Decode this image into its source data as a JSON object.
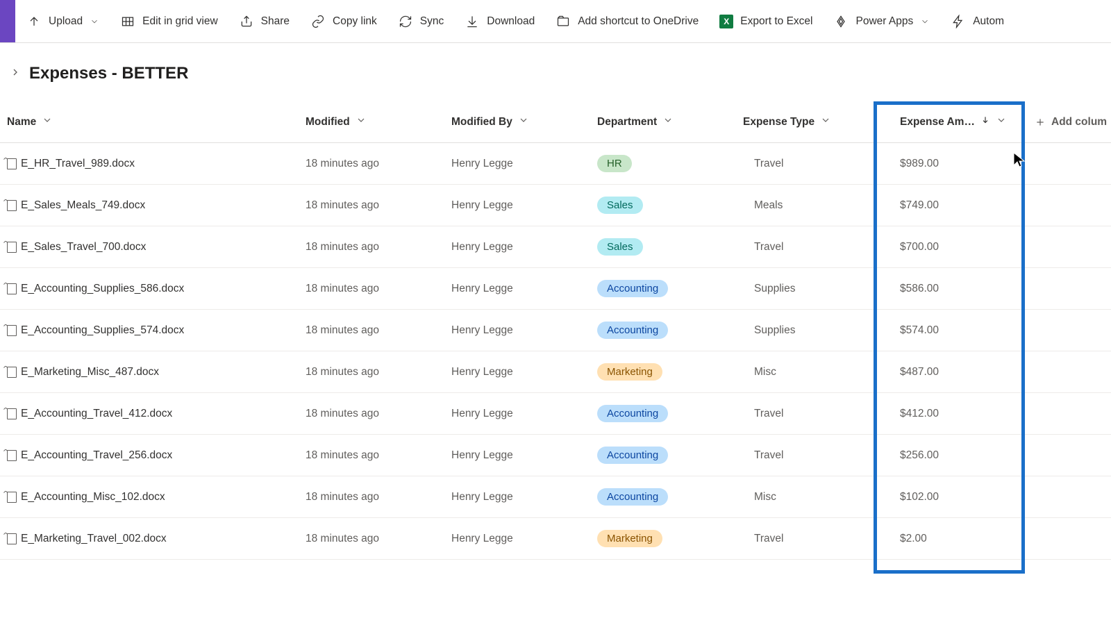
{
  "toolbar": {
    "upload": "Upload",
    "edit_grid": "Edit in grid view",
    "share": "Share",
    "copy_link": "Copy link",
    "sync": "Sync",
    "download": "Download",
    "add_shortcut": "Add shortcut to OneDrive",
    "export_excel": "Export to Excel",
    "power_apps": "Power Apps",
    "automate": "Autom"
  },
  "breadcrumb": {
    "title": "Expenses - BETTER"
  },
  "columns": {
    "name": "Name",
    "modified": "Modified",
    "modified_by": "Modified By",
    "department": "Department",
    "expense_type": "Expense Type",
    "expense_amount": "Expense Am…",
    "add_column": "Add colum"
  },
  "rows": [
    {
      "name": "E_HR_Travel_989.docx",
      "modified": "18 minutes ago",
      "modified_by": "Henry Legge",
      "dept": "HR",
      "dept_class": "pill-hr",
      "etype": "Travel",
      "amount": "$989.00"
    },
    {
      "name": "E_Sales_Meals_749.docx",
      "modified": "18 minutes ago",
      "modified_by": "Henry Legge",
      "dept": "Sales",
      "dept_class": "pill-sales",
      "etype": "Meals",
      "amount": "$749.00"
    },
    {
      "name": "E_Sales_Travel_700.docx",
      "modified": "18 minutes ago",
      "modified_by": "Henry Legge",
      "dept": "Sales",
      "dept_class": "pill-sales",
      "etype": "Travel",
      "amount": "$700.00"
    },
    {
      "name": "E_Accounting_Supplies_586.docx",
      "modified": "18 minutes ago",
      "modified_by": "Henry Legge",
      "dept": "Accounting",
      "dept_class": "pill-accounting",
      "etype": "Supplies",
      "amount": "$586.00"
    },
    {
      "name": "E_Accounting_Supplies_574.docx",
      "modified": "18 minutes ago",
      "modified_by": "Henry Legge",
      "dept": "Accounting",
      "dept_class": "pill-accounting",
      "etype": "Supplies",
      "amount": "$574.00"
    },
    {
      "name": "E_Marketing_Misc_487.docx",
      "modified": "18 minutes ago",
      "modified_by": "Henry Legge",
      "dept": "Marketing",
      "dept_class": "pill-marketing",
      "etype": "Misc",
      "amount": "$487.00"
    },
    {
      "name": "E_Accounting_Travel_412.docx",
      "modified": "18 minutes ago",
      "modified_by": "Henry Legge",
      "dept": "Accounting",
      "dept_class": "pill-accounting",
      "etype": "Travel",
      "amount": "$412.00"
    },
    {
      "name": "E_Accounting_Travel_256.docx",
      "modified": "18 minutes ago",
      "modified_by": "Henry Legge",
      "dept": "Accounting",
      "dept_class": "pill-accounting",
      "etype": "Travel",
      "amount": "$256.00"
    },
    {
      "name": "E_Accounting_Misc_102.docx",
      "modified": "18 minutes ago",
      "modified_by": "Henry Legge",
      "dept": "Accounting",
      "dept_class": "pill-accounting",
      "etype": "Misc",
      "amount": "$102.00"
    },
    {
      "name": "E_Marketing_Travel_002.docx",
      "modified": "18 minutes ago",
      "modified_by": "Henry Legge",
      "dept": "Marketing",
      "dept_class": "pill-marketing",
      "etype": "Travel",
      "amount": "$2.00"
    }
  ]
}
